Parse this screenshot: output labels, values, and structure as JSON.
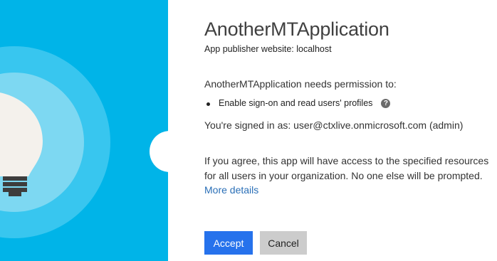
{
  "app": {
    "name": "AnotherMTApplication",
    "publisher_text": "App publisher website: localhost"
  },
  "consent": {
    "needs_permission": "AnotherMTApplication needs permission to:",
    "permissions": [
      {
        "label": "Enable sign-on and read users' profiles",
        "help_icon": "?"
      }
    ],
    "signed_in": "You're signed in as: user@ctxlive.onmicrosoft.com (admin)",
    "agreement_text": "If you agree, this app will have access to the specified resources for all users in your organization. No one else will be prompted.",
    "more_details_label": "More details"
  },
  "buttons": {
    "accept_label": "Accept",
    "cancel_label": "Cancel"
  },
  "colors": {
    "hero_background": "#00b4e8",
    "accept_button": "#2672ec",
    "cancel_button": "#cccccc",
    "link": "#2a6fb7"
  },
  "icons": {
    "hero": "lightbulb-illustration",
    "help": "question-circle-icon"
  }
}
